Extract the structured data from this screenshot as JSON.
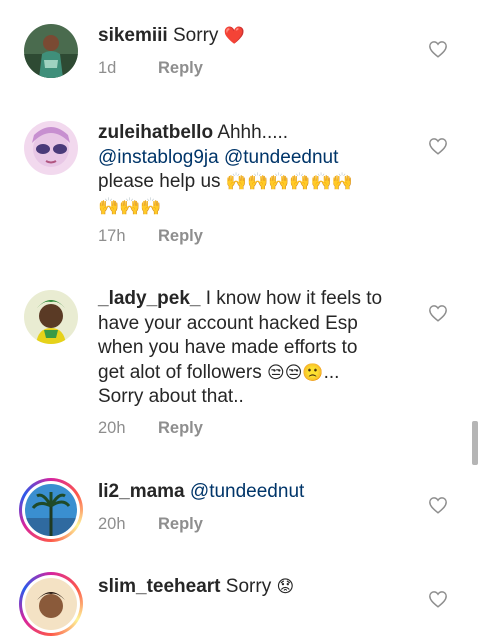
{
  "comments": [
    {
      "username": "sikemiii",
      "text": "Sorry",
      "emoji": "❤️",
      "time": "1d",
      "reply": "Reply"
    },
    {
      "username": "zuleihatbello",
      "text": "Ahhh.....",
      "mention1": "@instablog9ja",
      "mention2": "@tundeednut",
      "text2": "please help us",
      "emoji_line1": "🙌🙌🙌🙌🙌🙌",
      "emoji_line2": "🙌🙌🙌",
      "time": "17h",
      "reply": "Reply"
    },
    {
      "username": "_lady_pek_",
      "line1": "I know how it feels to",
      "line2": "have your account hacked Esp",
      "line3": "when you have made efforts to",
      "line4": "get alot of followers",
      "emoji": "😒😒🙁",
      "ellipsis": "...",
      "line5": "Sorry about that..",
      "time": "20h",
      "reply": "Reply"
    },
    {
      "username": "li2_mama",
      "mention": "@tundeednut",
      "time": "20h",
      "reply": "Reply"
    },
    {
      "username": "slim_teeheart",
      "text": "Sorry",
      "emoji": "😟"
    }
  ],
  "colors": {
    "text": "#262626",
    "mention": "#003569",
    "meta": "#8e8e8e",
    "heart_outline": "#8e8e8e",
    "red_heart": "#e0242e"
  }
}
